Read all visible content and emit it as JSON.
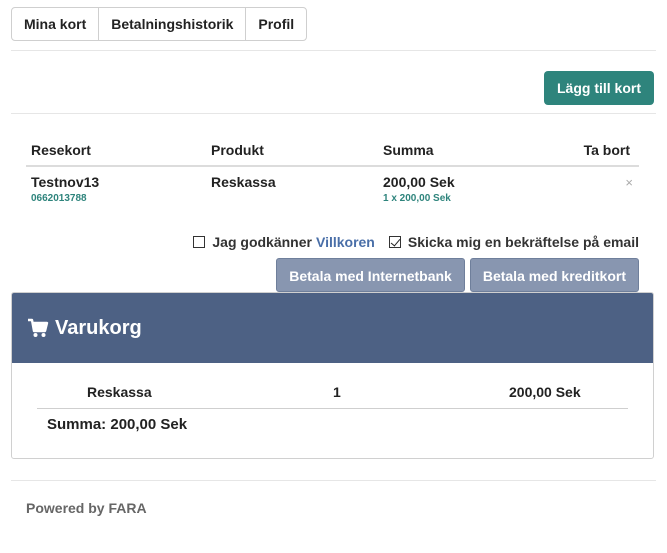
{
  "tabs": [
    "Mina kort",
    "Betalningshistorik",
    "Profil"
  ],
  "add_card_label": "Lägg till kort",
  "table": {
    "headers": [
      "Resekort",
      "Produkt",
      "Summa",
      "Ta bort"
    ],
    "row": {
      "card_name": "Testnov13",
      "card_number": "0662013788",
      "product": "Reskassa",
      "sum": "200,00 Sek",
      "sum_detail": "1 x 200,00 Sek",
      "remove_symbol": "×"
    }
  },
  "terms": {
    "agree_text": "Jag godkänner",
    "agree_link": "Villkoren",
    "agree_checked": false,
    "email_text": "Skicka mig en bekräftelse på email",
    "email_checked": true
  },
  "pay_buttons": [
    "Betala med Internetbank",
    "Betala med kreditkort"
  ],
  "cart": {
    "title": "Varukorg",
    "icon": "cart-icon",
    "item": {
      "product": "Reskassa",
      "qty": "1",
      "price": "200,00 Sek"
    },
    "total": "Summa: 200,00 Sek"
  },
  "footer": "Powered by FARA",
  "colors": {
    "accent": "#2e847c",
    "cart_header": "#4d6184",
    "pay_button": "#8896b0",
    "link": "#4a6fa8"
  }
}
